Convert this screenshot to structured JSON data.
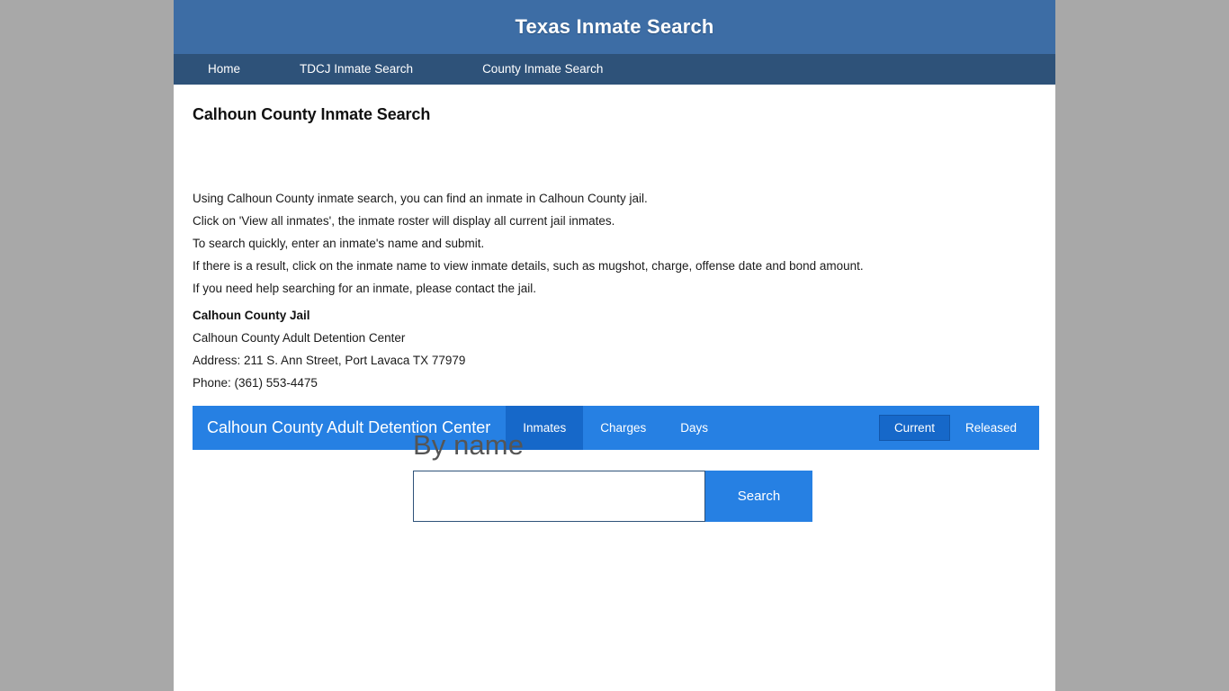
{
  "site": {
    "title": "Texas Inmate Search",
    "header_bg": "#3d6da5",
    "nav_bg": "#2e5279",
    "accent": "#2680e3",
    "accent_dark": "#1668c9"
  },
  "nav": {
    "items": [
      {
        "label": "Home"
      },
      {
        "label": "TDCJ Inmate Search"
      },
      {
        "label": "County Inmate Search"
      }
    ]
  },
  "main": {
    "page_title": "Calhoun County Inmate Search",
    "intro_lines": [
      "Using Calhoun County inmate search, you can find an inmate in Calhoun County jail.",
      "Click on 'View all inmates', the inmate roster will display all current jail inmates.",
      "To search quickly, enter an inmate's name and submit.",
      "If there is a result, click on the inmate name to view inmate details, such as mugshot, charge, offense date and bond amount.",
      "If you need help searching for an inmate, please contact the jail."
    ],
    "jail": {
      "heading": "Calhoun County Jail",
      "facility": "Calhoun County Adult Detention Center",
      "address": "Address: 211 S. Ann Street, Port Lavaca TX 77979",
      "phone": "Phone: (361) 553-4475"
    }
  },
  "toolbar": {
    "brand": "Calhoun County Adult Detention Center",
    "tabs": [
      {
        "label": "Inmates",
        "active": true
      },
      {
        "label": "Charges",
        "active": false
      },
      {
        "label": "Days",
        "active": false
      }
    ],
    "filters": [
      {
        "label": "Current",
        "active": true
      },
      {
        "label": "Released",
        "active": false
      }
    ]
  },
  "search": {
    "heading": "By name",
    "input_value": "",
    "input_placeholder": "",
    "button_label": "Search"
  }
}
